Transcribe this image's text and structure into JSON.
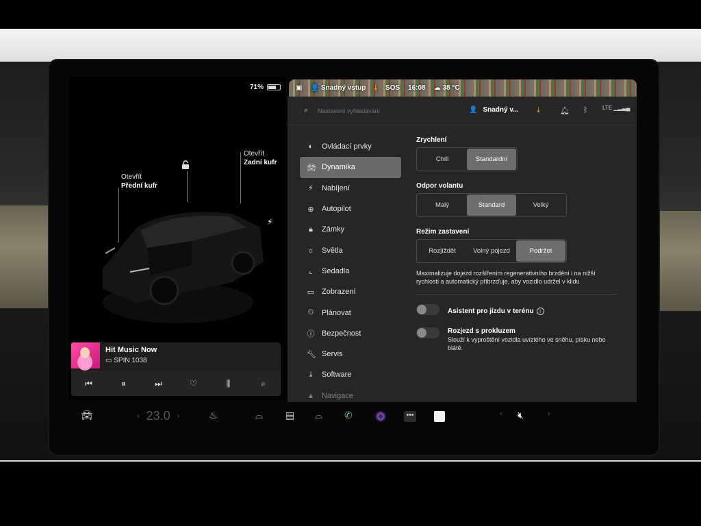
{
  "left_panel": {
    "battery_percent": "71%",
    "battery_level": 0.71,
    "front_trunk": {
      "action": "Otevřít",
      "name": "Přední kufr"
    },
    "rear_trunk": {
      "action": "Otevřít",
      "name": "Zadní kufr"
    },
    "icons": {
      "lock": "unlock-icon",
      "charge": "bolt-icon"
    }
  },
  "media": {
    "title": "Hit Music Now",
    "source": "SPIN 1038",
    "controls": [
      "previous-icon",
      "pause-icon",
      "next-icon",
      "heart-icon",
      "equalizer-icon",
      "search-icon"
    ]
  },
  "status_bar": {
    "profile": "Snadný vstup",
    "sos": "SOS",
    "time": "16:08",
    "temperature": "38 °C"
  },
  "topbar": {
    "search_placeholder": "Nastavení vyhledávání",
    "profile_name": "Snadný v...",
    "lte": "LTE"
  },
  "nav": {
    "items": [
      {
        "label": "Ovládací prvky",
        "icon": "toggle-icon"
      },
      {
        "label": "Dynamika",
        "icon": "car-icon",
        "active": true
      },
      {
        "label": "Nabíjení",
        "icon": "bolt-icon"
      },
      {
        "label": "Autopilot",
        "icon": "steering-wheel-icon"
      },
      {
        "label": "Zámky",
        "icon": "lock-icon"
      },
      {
        "label": "Světla",
        "icon": "sun-icon"
      },
      {
        "label": "Sedadla",
        "icon": "seat-icon"
      },
      {
        "label": "Zobrazení",
        "icon": "display-icon"
      },
      {
        "label": "Plánovat",
        "icon": "clock-icon"
      },
      {
        "label": "Bezpečnost",
        "icon": "info-circle-icon"
      },
      {
        "label": "Servis",
        "icon": "wrench-icon"
      },
      {
        "label": "Software",
        "icon": "download-icon"
      },
      {
        "label": "Navigace",
        "icon": "navigation-icon"
      }
    ]
  },
  "dynamics": {
    "acceleration": {
      "title": "Zrychlení",
      "options": [
        "Chill",
        "Standardní"
      ],
      "selected": "Standardní"
    },
    "steering": {
      "title": "Odpor volantu",
      "options": [
        "Malý",
        "Standard",
        "Velký"
      ],
      "selected": "Standard"
    },
    "stopping": {
      "title": "Režim zastavení",
      "options": [
        "Rozjíždět",
        "Volný pojezd",
        "Podržet"
      ],
      "selected": "Podržet"
    },
    "stopping_desc": "Maximalizuje dojezd rozšířením regenerativního brzdění i na nižší rychlosti a automatický přibrzďuje, aby vozidlo udržel v klidu",
    "offroad": {
      "label": "Asistent pro jízdu v terénu",
      "enabled": false
    },
    "slip_start": {
      "label": "Rozjezd s prokluzem",
      "desc": "Slouží k vyproštění vozidla uvízlého ve sněhu, písku nebo blátě.",
      "enabled": false
    }
  },
  "dock": {
    "temperature": "23.0",
    "icons": [
      "car-icon",
      "seat-heater-icon",
      "defrost-front-icon",
      "defrost-rear-icon",
      "defrost-auto-icon",
      "phone-icon",
      "camera-icon",
      "more-icon",
      "notes-icon",
      "volume-mute-icon"
    ]
  },
  "colors": {
    "active_nav": "#6a6a6a",
    "panel_bg": "#262626",
    "phone_green": "#6cd48a",
    "download_orange": "#f0a030"
  }
}
